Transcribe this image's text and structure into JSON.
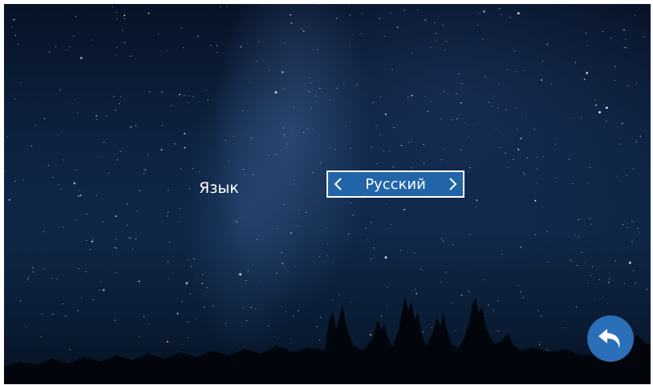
{
  "language_setting": {
    "label": "Язык",
    "selected_value": "Русский",
    "prev_icon": "chevron-left-icon",
    "next_icon": "chevron-right-icon"
  },
  "back_button": {
    "icon": "undo-arrow-icon"
  },
  "colors": {
    "selector_bg": "#2264a8",
    "back_button_bg": "#2a6fb8",
    "text": "#ffffff"
  }
}
